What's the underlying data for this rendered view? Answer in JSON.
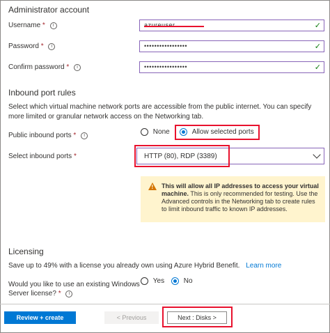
{
  "admin": {
    "heading": "Administrator account",
    "username_label": "Username",
    "password_label": "Password",
    "confirm_label": "Confirm password",
    "required_mark": "*",
    "username_value": "azureuser",
    "password_value": "•••••••••••••••••",
    "confirm_value": "•••••••••••••••••"
  },
  "inbound": {
    "heading": "Inbound port rules",
    "description": "Select which virtual machine network ports are accessible from the public internet. You can specify more limited or granular network access on the Networking tab.",
    "public_label": "Public inbound ports",
    "option_none": "None",
    "option_allow": "Allow selected ports",
    "select_label": "Select inbound ports",
    "select_value": "HTTP (80), RDP (3389)",
    "warning_bold": "This will allow all IP addresses to access your virtual machine.",
    "warning_text": " This is only recommended for testing.  Use the Advanced controls in the Networking tab to create rules to limit inbound traffic to known IP addresses."
  },
  "licensing": {
    "heading": "Licensing",
    "description": "Save up to 49% with a license you already own using Azure Hybrid Benefit.",
    "learn_more": "Learn more",
    "question_line1": "Would you like to use an existing Windows",
    "question_line2": "Server license?",
    "option_yes": "Yes",
    "option_no": "No"
  },
  "footer": {
    "review_label": "Review + create",
    "previous_label": "< Previous",
    "next_label": "Next : Disks >"
  },
  "colors": {
    "primary": "#0078d4",
    "highlight_red": "#e8112d",
    "field_border": "#8764b8",
    "warning_bg": "#fff4ce",
    "check_green": "#107c10"
  }
}
